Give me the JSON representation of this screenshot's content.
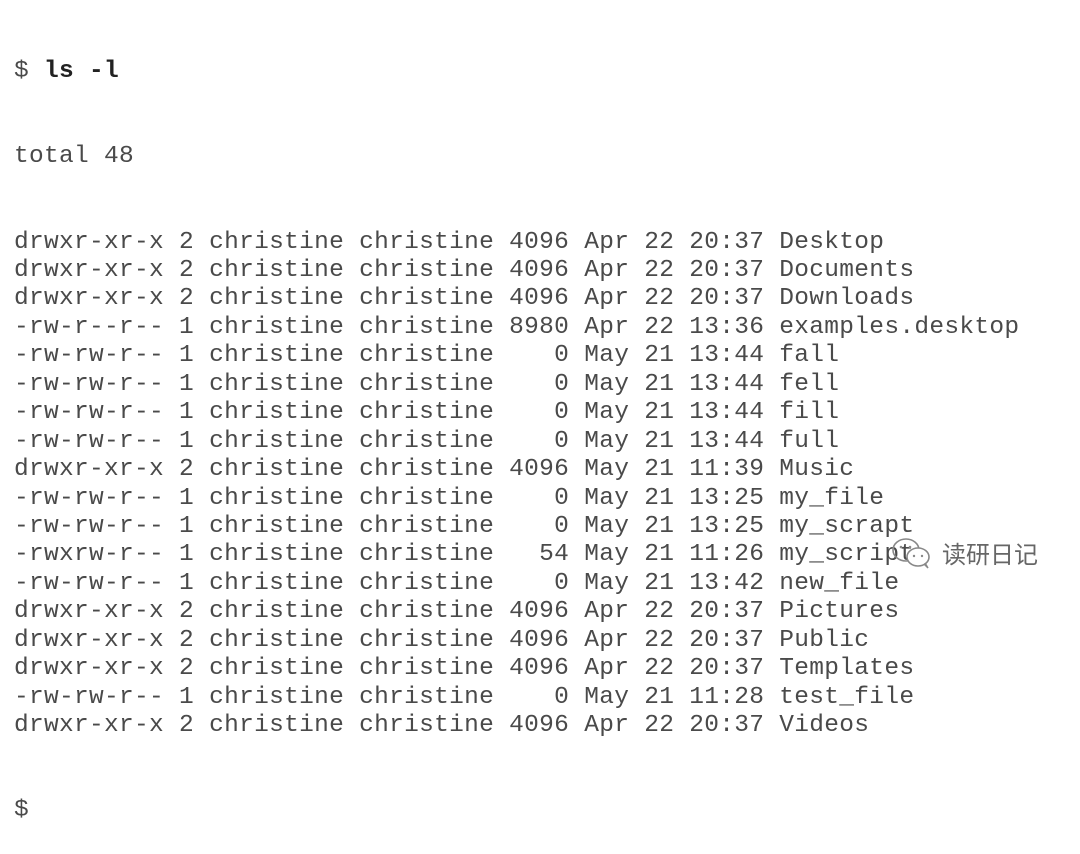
{
  "terminal": {
    "prompt": "$",
    "command": "ls -l",
    "total_line": "total 48",
    "entries": [
      {
        "perms": "drwxr-xr-x",
        "links": "2",
        "owner": "christine",
        "group": "christine",
        "size": "4096",
        "month": "Apr",
        "day": "22",
        "time": "20:37",
        "name": "Desktop"
      },
      {
        "perms": "drwxr-xr-x",
        "links": "2",
        "owner": "christine",
        "group": "christine",
        "size": "4096",
        "month": "Apr",
        "day": "22",
        "time": "20:37",
        "name": "Documents"
      },
      {
        "perms": "drwxr-xr-x",
        "links": "2",
        "owner": "christine",
        "group": "christine",
        "size": "4096",
        "month": "Apr",
        "day": "22",
        "time": "20:37",
        "name": "Downloads"
      },
      {
        "perms": "-rw-r--r--",
        "links": "1",
        "owner": "christine",
        "group": "christine",
        "size": "8980",
        "month": "Apr",
        "day": "22",
        "time": "13:36",
        "name": "examples.desktop"
      },
      {
        "perms": "-rw-rw-r--",
        "links": "1",
        "owner": "christine",
        "group": "christine",
        "size": "0",
        "month": "May",
        "day": "21",
        "time": "13:44",
        "name": "fall"
      },
      {
        "perms": "-rw-rw-r--",
        "links": "1",
        "owner": "christine",
        "group": "christine",
        "size": "0",
        "month": "May",
        "day": "21",
        "time": "13:44",
        "name": "fell"
      },
      {
        "perms": "-rw-rw-r--",
        "links": "1",
        "owner": "christine",
        "group": "christine",
        "size": "0",
        "month": "May",
        "day": "21",
        "time": "13:44",
        "name": "fill"
      },
      {
        "perms": "-rw-rw-r--",
        "links": "1",
        "owner": "christine",
        "group": "christine",
        "size": "0",
        "month": "May",
        "day": "21",
        "time": "13:44",
        "name": "full"
      },
      {
        "perms": "drwxr-xr-x",
        "links": "2",
        "owner": "christine",
        "group": "christine",
        "size": "4096",
        "month": "May",
        "day": "21",
        "time": "11:39",
        "name": "Music"
      },
      {
        "perms": "-rw-rw-r--",
        "links": "1",
        "owner": "christine",
        "group": "christine",
        "size": "0",
        "month": "May",
        "day": "21",
        "time": "13:25",
        "name": "my_file"
      },
      {
        "perms": "-rw-rw-r--",
        "links": "1",
        "owner": "christine",
        "group": "christine",
        "size": "0",
        "month": "May",
        "day": "21",
        "time": "13:25",
        "name": "my_scrapt"
      },
      {
        "perms": "-rwxrw-r--",
        "links": "1",
        "owner": "christine",
        "group": "christine",
        "size": "54",
        "month": "May",
        "day": "21",
        "time": "11:26",
        "name": "my_script"
      },
      {
        "perms": "-rw-rw-r--",
        "links": "1",
        "owner": "christine",
        "group": "christine",
        "size": "0",
        "month": "May",
        "day": "21",
        "time": "13:42",
        "name": "new_file"
      },
      {
        "perms": "drwxr-xr-x",
        "links": "2",
        "owner": "christine",
        "group": "christine",
        "size": "4096",
        "month": "Apr",
        "day": "22",
        "time": "20:37",
        "name": "Pictures"
      },
      {
        "perms": "drwxr-xr-x",
        "links": "2",
        "owner": "christine",
        "group": "christine",
        "size": "4096",
        "month": "Apr",
        "day": "22",
        "time": "20:37",
        "name": "Public"
      },
      {
        "perms": "drwxr-xr-x",
        "links": "2",
        "owner": "christine",
        "group": "christine",
        "size": "4096",
        "month": "Apr",
        "day": "22",
        "time": "20:37",
        "name": "Templates"
      },
      {
        "perms": "-rw-rw-r--",
        "links": "1",
        "owner": "christine",
        "group": "christine",
        "size": "0",
        "month": "May",
        "day": "21",
        "time": "11:28",
        "name": "test_file"
      },
      {
        "perms": "drwxr-xr-x",
        "links": "2",
        "owner": "christine",
        "group": "christine",
        "size": "4096",
        "month": "Apr",
        "day": "22",
        "time": "20:37",
        "name": "Videos"
      }
    ],
    "final_prompt": "$"
  },
  "watermark": {
    "icon": "wechat-icon",
    "text": "读研日记"
  }
}
